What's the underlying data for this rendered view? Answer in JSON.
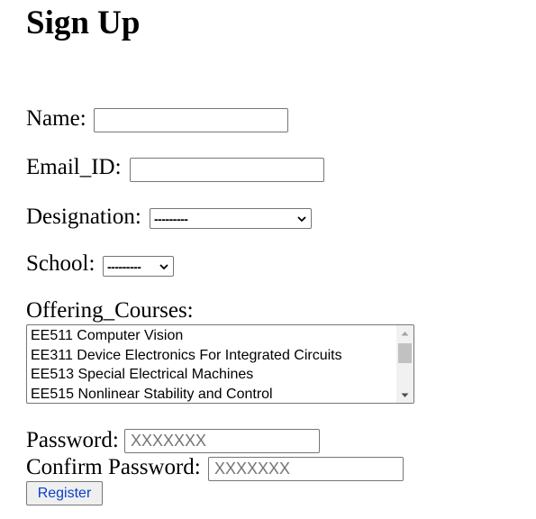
{
  "form": {
    "title": "Sign Up",
    "name": {
      "label": "Name:",
      "value": ""
    },
    "email": {
      "label": "Email_ID:",
      "value": ""
    },
    "designation": {
      "label": "Designation:",
      "selected": "---------"
    },
    "school": {
      "label": "School:",
      "selected": "---------"
    },
    "offering_courses": {
      "label": "Offering_Courses:",
      "options": [
        "EE511 Computer Vision",
        "EE311 Device Electronics For Integrated Circuits",
        "EE513 Special Electrical Machines",
        "EE515 Nonlinear Stability and Control"
      ]
    },
    "password": {
      "label": "Password:",
      "placeholder": "XXXXXXX",
      "value": ""
    },
    "confirm_password": {
      "label": "Confirm Password:",
      "placeholder": "XXXXXXX",
      "value": ""
    },
    "register_label": "Register"
  }
}
